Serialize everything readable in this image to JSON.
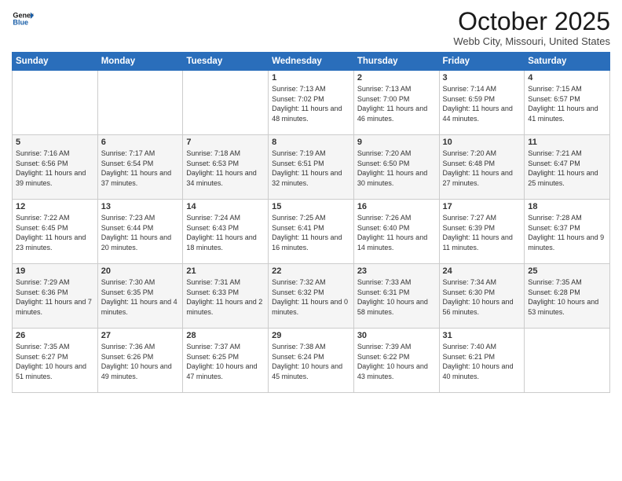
{
  "header": {
    "logo_line1": "General",
    "logo_line2": "Blue",
    "month": "October 2025",
    "location": "Webb City, Missouri, United States"
  },
  "weekdays": [
    "Sunday",
    "Monday",
    "Tuesday",
    "Wednesday",
    "Thursday",
    "Friday",
    "Saturday"
  ],
  "weeks": [
    [
      {
        "day": "",
        "info": ""
      },
      {
        "day": "",
        "info": ""
      },
      {
        "day": "",
        "info": ""
      },
      {
        "day": "1",
        "info": "Sunrise: 7:13 AM\nSunset: 7:02 PM\nDaylight: 11 hours\nand 48 minutes."
      },
      {
        "day": "2",
        "info": "Sunrise: 7:13 AM\nSunset: 7:00 PM\nDaylight: 11 hours\nand 46 minutes."
      },
      {
        "day": "3",
        "info": "Sunrise: 7:14 AM\nSunset: 6:59 PM\nDaylight: 11 hours\nand 44 minutes."
      },
      {
        "day": "4",
        "info": "Sunrise: 7:15 AM\nSunset: 6:57 PM\nDaylight: 11 hours\nand 41 minutes."
      }
    ],
    [
      {
        "day": "5",
        "info": "Sunrise: 7:16 AM\nSunset: 6:56 PM\nDaylight: 11 hours\nand 39 minutes."
      },
      {
        "day": "6",
        "info": "Sunrise: 7:17 AM\nSunset: 6:54 PM\nDaylight: 11 hours\nand 37 minutes."
      },
      {
        "day": "7",
        "info": "Sunrise: 7:18 AM\nSunset: 6:53 PM\nDaylight: 11 hours\nand 34 minutes."
      },
      {
        "day": "8",
        "info": "Sunrise: 7:19 AM\nSunset: 6:51 PM\nDaylight: 11 hours\nand 32 minutes."
      },
      {
        "day": "9",
        "info": "Sunrise: 7:20 AM\nSunset: 6:50 PM\nDaylight: 11 hours\nand 30 minutes."
      },
      {
        "day": "10",
        "info": "Sunrise: 7:20 AM\nSunset: 6:48 PM\nDaylight: 11 hours\nand 27 minutes."
      },
      {
        "day": "11",
        "info": "Sunrise: 7:21 AM\nSunset: 6:47 PM\nDaylight: 11 hours\nand 25 minutes."
      }
    ],
    [
      {
        "day": "12",
        "info": "Sunrise: 7:22 AM\nSunset: 6:45 PM\nDaylight: 11 hours\nand 23 minutes."
      },
      {
        "day": "13",
        "info": "Sunrise: 7:23 AM\nSunset: 6:44 PM\nDaylight: 11 hours\nand 20 minutes."
      },
      {
        "day": "14",
        "info": "Sunrise: 7:24 AM\nSunset: 6:43 PM\nDaylight: 11 hours\nand 18 minutes."
      },
      {
        "day": "15",
        "info": "Sunrise: 7:25 AM\nSunset: 6:41 PM\nDaylight: 11 hours\nand 16 minutes."
      },
      {
        "day": "16",
        "info": "Sunrise: 7:26 AM\nSunset: 6:40 PM\nDaylight: 11 hours\nand 14 minutes."
      },
      {
        "day": "17",
        "info": "Sunrise: 7:27 AM\nSunset: 6:39 PM\nDaylight: 11 hours\nand 11 minutes."
      },
      {
        "day": "18",
        "info": "Sunrise: 7:28 AM\nSunset: 6:37 PM\nDaylight: 11 hours\nand 9 minutes."
      }
    ],
    [
      {
        "day": "19",
        "info": "Sunrise: 7:29 AM\nSunset: 6:36 PM\nDaylight: 11 hours\nand 7 minutes."
      },
      {
        "day": "20",
        "info": "Sunrise: 7:30 AM\nSunset: 6:35 PM\nDaylight: 11 hours\nand 4 minutes."
      },
      {
        "day": "21",
        "info": "Sunrise: 7:31 AM\nSunset: 6:33 PM\nDaylight: 11 hours\nand 2 minutes."
      },
      {
        "day": "22",
        "info": "Sunrise: 7:32 AM\nSunset: 6:32 PM\nDaylight: 11 hours\nand 0 minutes."
      },
      {
        "day": "23",
        "info": "Sunrise: 7:33 AM\nSunset: 6:31 PM\nDaylight: 10 hours\nand 58 minutes."
      },
      {
        "day": "24",
        "info": "Sunrise: 7:34 AM\nSunset: 6:30 PM\nDaylight: 10 hours\nand 56 minutes."
      },
      {
        "day": "25",
        "info": "Sunrise: 7:35 AM\nSunset: 6:28 PM\nDaylight: 10 hours\nand 53 minutes."
      }
    ],
    [
      {
        "day": "26",
        "info": "Sunrise: 7:35 AM\nSunset: 6:27 PM\nDaylight: 10 hours\nand 51 minutes."
      },
      {
        "day": "27",
        "info": "Sunrise: 7:36 AM\nSunset: 6:26 PM\nDaylight: 10 hours\nand 49 minutes."
      },
      {
        "day": "28",
        "info": "Sunrise: 7:37 AM\nSunset: 6:25 PM\nDaylight: 10 hours\nand 47 minutes."
      },
      {
        "day": "29",
        "info": "Sunrise: 7:38 AM\nSunset: 6:24 PM\nDaylight: 10 hours\nand 45 minutes."
      },
      {
        "day": "30",
        "info": "Sunrise: 7:39 AM\nSunset: 6:22 PM\nDaylight: 10 hours\nand 43 minutes."
      },
      {
        "day": "31",
        "info": "Sunrise: 7:40 AM\nSunset: 6:21 PM\nDaylight: 10 hours\nand 40 minutes."
      },
      {
        "day": "",
        "info": ""
      }
    ]
  ]
}
